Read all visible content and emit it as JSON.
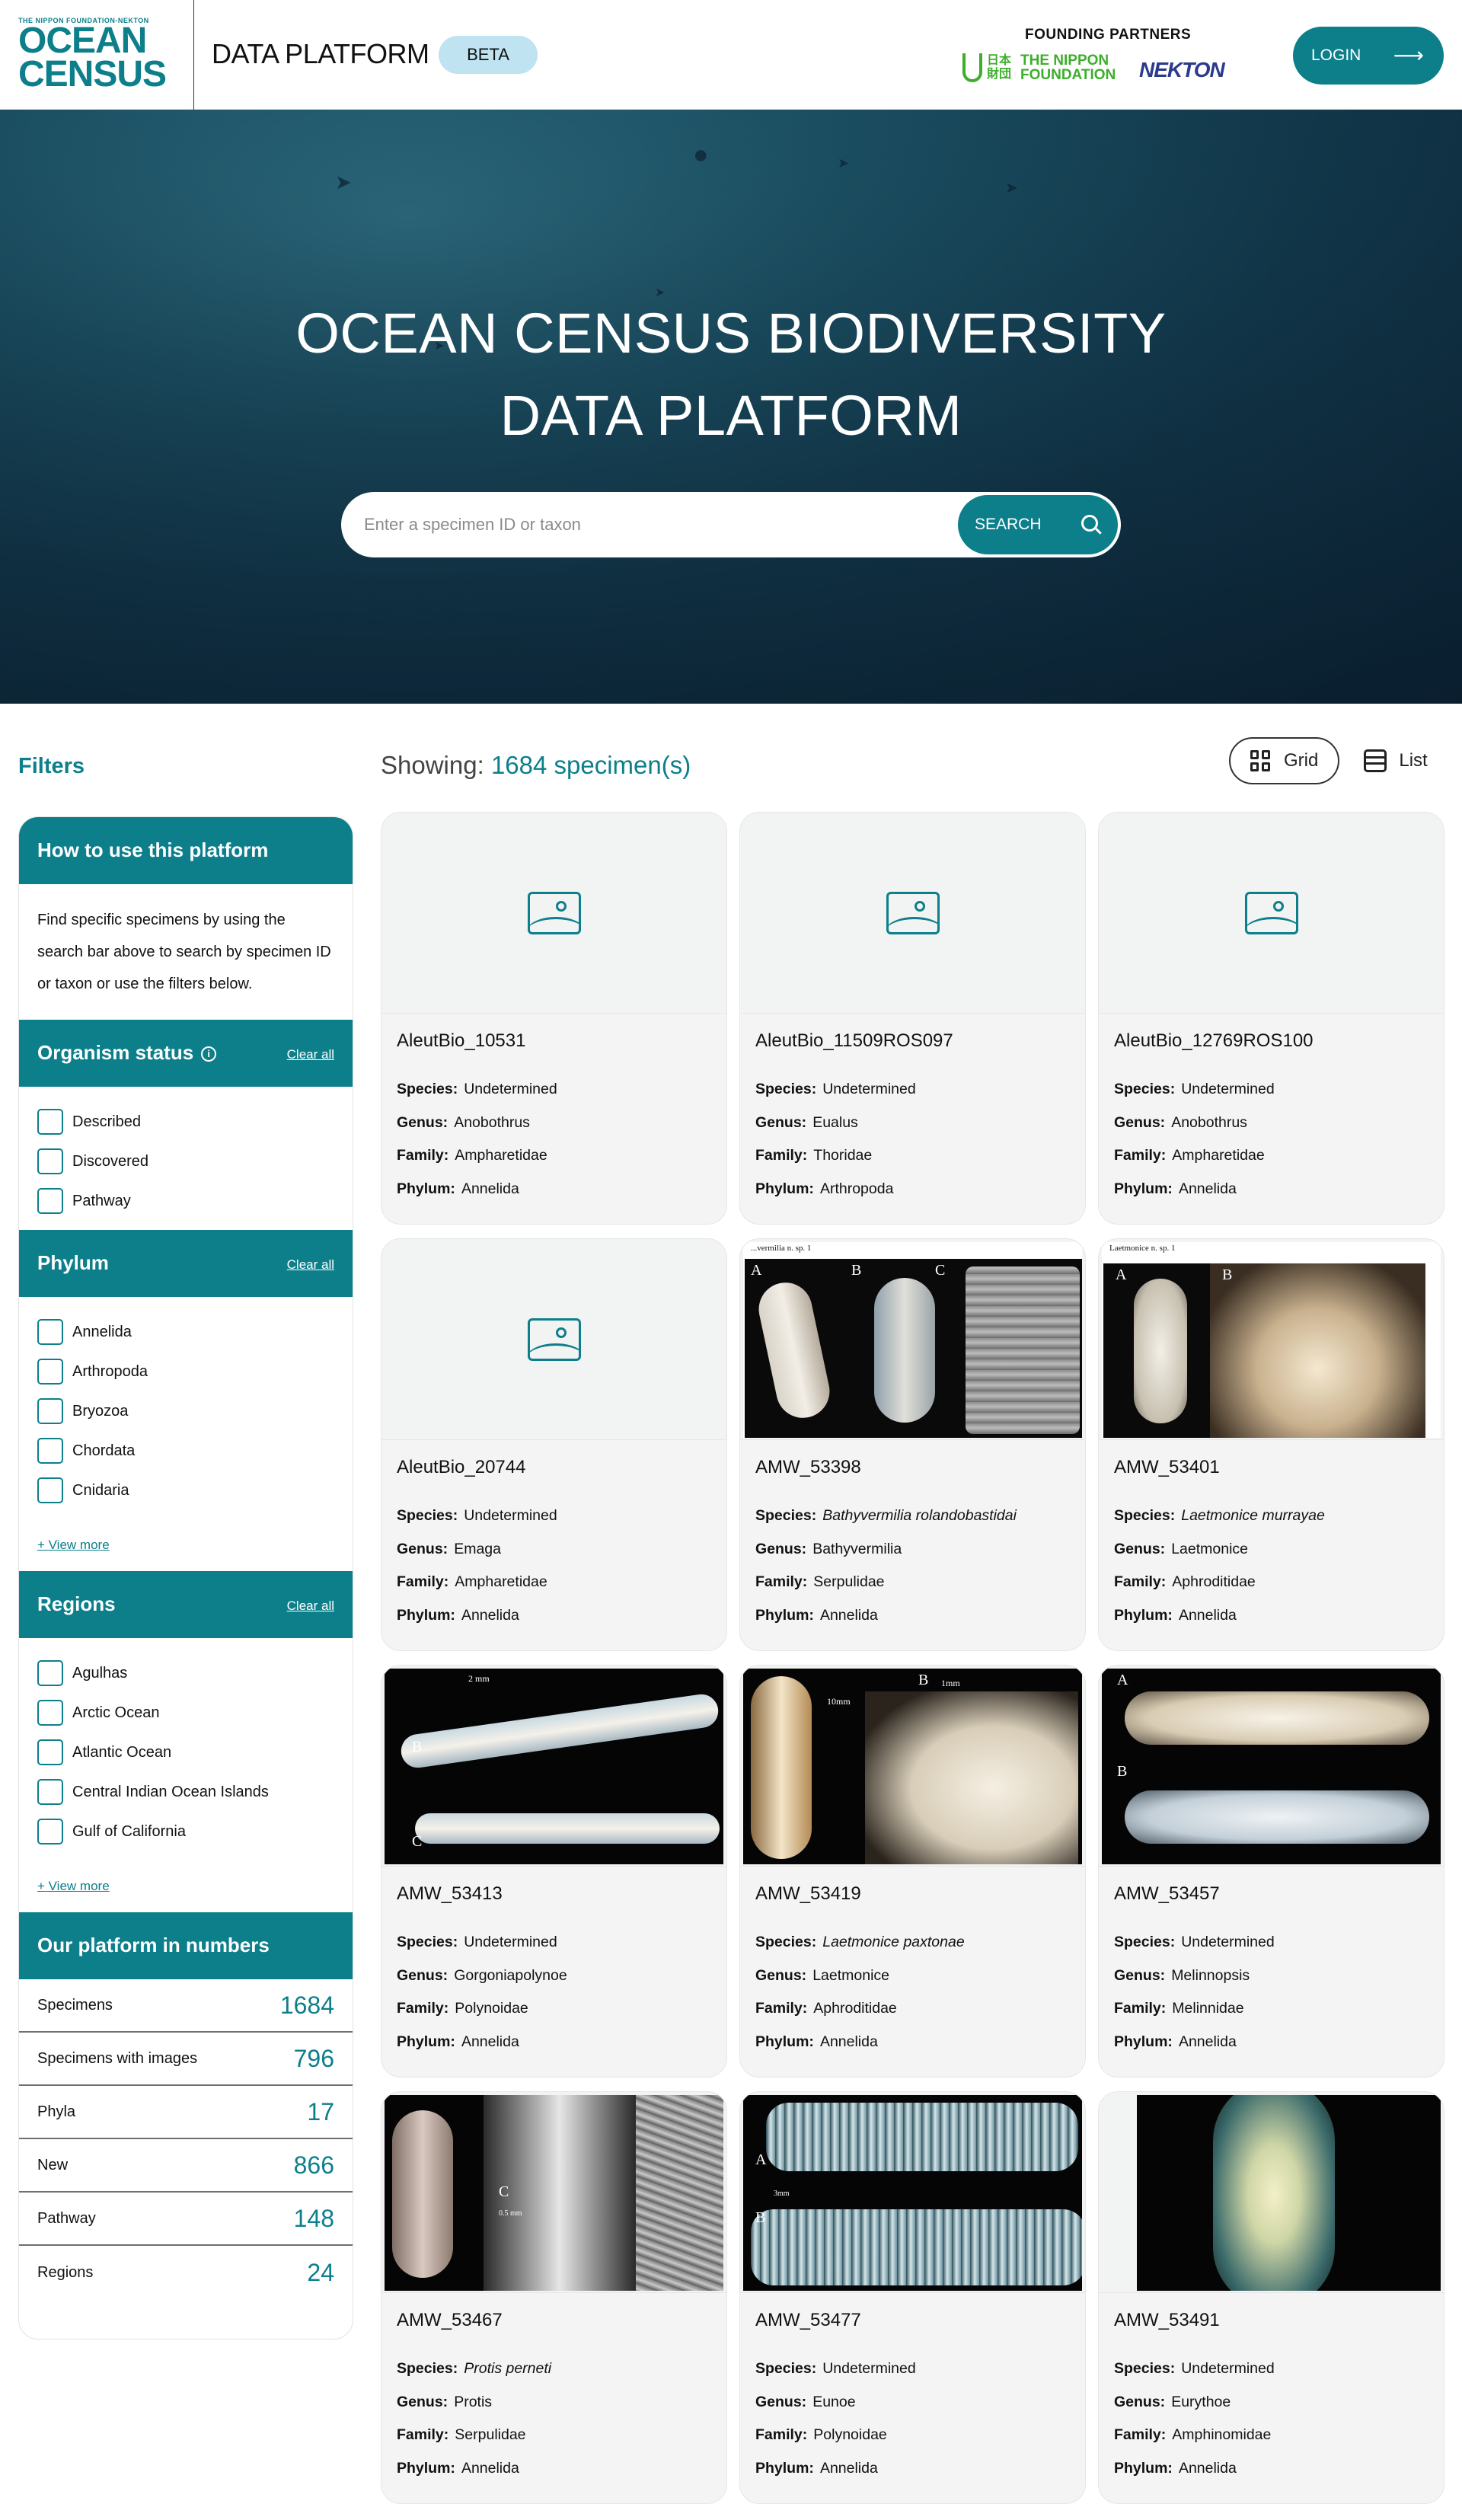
{
  "header": {
    "logo_small": "THE NIPPON FOUNDATION-NEKTON",
    "logo_line1": "OCEAN",
    "logo_line2": "CENSUS",
    "platform_title": "DATA PLATFORM",
    "beta_label": "BETA",
    "partners_label": "FOUNDING PARTNERS",
    "nippon_kanji": "日本 財団",
    "nippon_name_line1": "THE NIPPON",
    "nippon_name_line2": "FOUNDATION",
    "nekton_name": "NEKTON",
    "login_label": "LOGIN"
  },
  "hero": {
    "title_line1": "OCEAN CENSUS BIODIVERSITY",
    "title_line2": "DATA PLATFORM",
    "search_placeholder": "Enter a specimen ID or taxon",
    "search_button": "SEARCH"
  },
  "sidebar": {
    "filters_title": "Filters",
    "how_to": {
      "title": "How to use this platform",
      "text": "Find specific specimens by using the search bar above to search by specimen ID or taxon or use the filters below."
    },
    "organism_status": {
      "title": "Organism status",
      "clear": "Clear all",
      "options": [
        "Described",
        "Discovered",
        "Pathway"
      ]
    },
    "phylum": {
      "title": "Phylum",
      "clear": "Clear all",
      "options": [
        "Annelida",
        "Arthropoda",
        "Bryozoa",
        "Chordata",
        "Cnidaria"
      ],
      "view_more": "+ View more"
    },
    "regions": {
      "title": "Regions",
      "clear": "Clear all",
      "options": [
        "Agulhas",
        "Arctic Ocean",
        "Atlantic Ocean",
        "Central Indian Ocean Islands",
        "Gulf of California"
      ],
      "view_more": "+ View more"
    },
    "numbers": {
      "title": "Our platform in numbers",
      "rows": [
        {
          "label": "Specimens",
          "value": "1684"
        },
        {
          "label": "Specimens with images",
          "value": "796"
        },
        {
          "label": "Phyla",
          "value": "17"
        },
        {
          "label": "New",
          "value": "866"
        },
        {
          "label": "Pathway",
          "value": "148"
        },
        {
          "label": "Regions",
          "value": "24"
        }
      ]
    }
  },
  "results": {
    "showing_label": "Showing:",
    "showing_count": "1684 specimen(s)",
    "view_grid": "Grid",
    "view_list": "List",
    "field_labels": {
      "species": "Species:",
      "genus": "Genus:",
      "family": "Family:",
      "phylum": "Phylum:"
    },
    "cards": [
      {
        "id": "AleutBio_10531",
        "species": "Undetermined",
        "genus": "Anobothrus",
        "family": "Ampharetidae",
        "phylum": "Annelida"
      },
      {
        "id": "AleutBio_11509ROS097",
        "species": "Undetermined",
        "genus": "Eualus",
        "family": "Thoridae",
        "phylum": "Arthropoda"
      },
      {
        "id": "AleutBio_12769ROS100",
        "species": "Undetermined",
        "genus": "Anobothrus",
        "family": "Ampharetidae",
        "phylum": "Annelida"
      },
      {
        "id": "AleutBio_20744",
        "species": "Undetermined",
        "genus": "Emaga",
        "family": "Ampharetidae",
        "phylum": "Annelida"
      },
      {
        "id": "AMW_53398",
        "species": "Bathyvermilia rolandobastidai",
        "genus": "Bathyvermilia",
        "family": "Serpulidae",
        "phylum": "Annelida",
        "caption": "...vermilia n. sp. 1"
      },
      {
        "id": "AMW_53401",
        "species": "Laetmonice murrayae",
        "genus": "Laetmonice",
        "family": "Aphroditidae",
        "phylum": "Annelida",
        "caption": "Laetmonice n. sp. 1"
      },
      {
        "id": "AMW_53413",
        "species": "Undetermined",
        "genus": "Gorgoniapolynoe",
        "family": "Polynoidae",
        "phylum": "Annelida"
      },
      {
        "id": "AMW_53419",
        "species": "Laetmonice paxtonae",
        "genus": "Laetmonice",
        "family": "Aphroditidae",
        "phylum": "Annelida"
      },
      {
        "id": "AMW_53457",
        "species": "Undetermined",
        "genus": "Melinnopsis",
        "family": "Melinnidae",
        "phylum": "Annelida"
      },
      {
        "id": "AMW_53467",
        "species": "Protis perneti",
        "genus": "Protis",
        "family": "Serpulidae",
        "phylum": "Annelida"
      },
      {
        "id": "AMW_53477",
        "species": "Undetermined",
        "genus": "Eunoe",
        "family": "Polynoidae",
        "phylum": "Annelida"
      },
      {
        "id": "AMW_53491",
        "species": "Undetermined",
        "genus": "Eurythoe",
        "family": "Amphinomidae",
        "phylum": "Annelida"
      }
    ],
    "photo_labels": {
      "a": "A",
      "b": "B",
      "c": "C",
      "scale_2mm": "2 mm",
      "scale_1mm": "1mm",
      "scale_10mm": "10mm",
      "scale_10_mm": "10 mm",
      "scale_5mm": "5 mm",
      "scale_05mm": "0.5 mm",
      "scale_3mm": "3mm"
    }
  },
  "colors": {
    "accent": "#0c7f8b",
    "beta_bg": "#bfe3f0",
    "partner_green": "#3dae2b",
    "partner_blue": "#2b3a8c"
  }
}
